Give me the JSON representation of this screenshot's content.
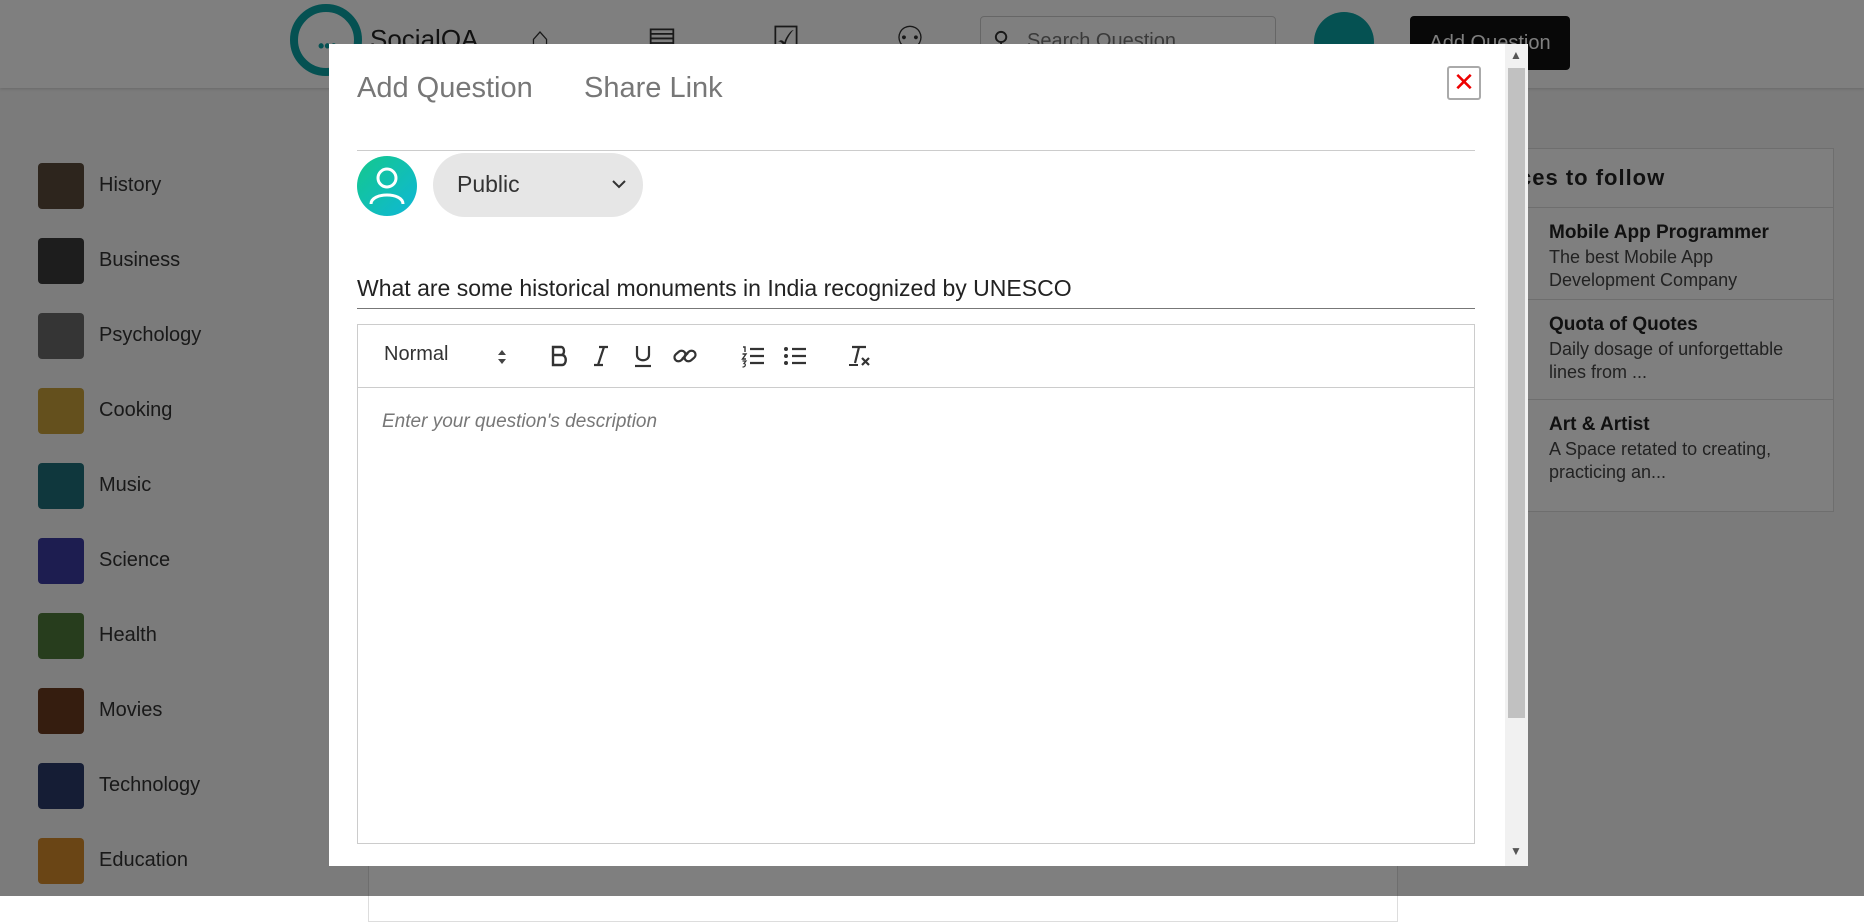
{
  "app": {
    "logo_text": "SocialQA",
    "search_placeholder": "Search Question",
    "add_question_button": "Add Question"
  },
  "sidebar": {
    "items": [
      {
        "label": "History",
        "color": "#5b4a3a"
      },
      {
        "label": "Business",
        "color": "#3a3a3a"
      },
      {
        "label": "Psychology",
        "color": "#6b6b6b"
      },
      {
        "label": "Cooking",
        "color": "#c9a13a"
      },
      {
        "label": "Music",
        "color": "#1f6f7a"
      },
      {
        "label": "Science",
        "color": "#3a3aa0"
      },
      {
        "label": "Health",
        "color": "#4f7a3a"
      },
      {
        "label": "Movies",
        "color": "#6a3a1f"
      },
      {
        "label": "Technology",
        "color": "#2a3a6a"
      },
      {
        "label": "Education",
        "color": "#d48a2a"
      }
    ]
  },
  "spaces": {
    "title": "ces to follow",
    "items": [
      {
        "name": "Mobile App Programmer",
        "description": "The best Mobile App Development Company"
      },
      {
        "name": "Quota of Quotes",
        "description": "Daily dosage of unforgettable lines from ..."
      },
      {
        "name": "Art & Artist",
        "description": "A Space retated to creating, practicing an..."
      }
    ]
  },
  "modal": {
    "tabs": [
      "Add Question",
      "Share Link"
    ],
    "close_symbol": "✕",
    "visibility": "Public",
    "question_value": "What are some historical monuments in India recognized by UNESCO",
    "editor": {
      "format_label": "Normal",
      "placeholder": "Enter your question's description"
    }
  },
  "colors": {
    "accent": "#0aa2a4",
    "close_red": "#e00000",
    "avatar_gradient_start": "#14c88c",
    "avatar_gradient_end": "#0fb7d7"
  }
}
